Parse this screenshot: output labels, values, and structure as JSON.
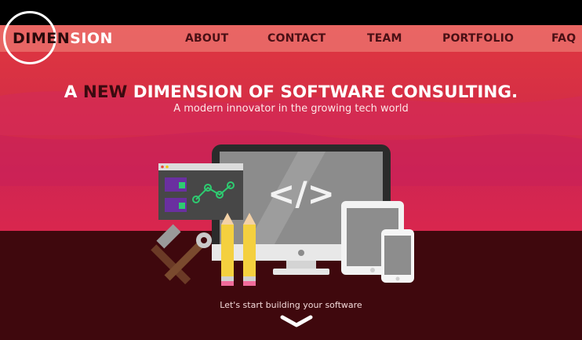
{
  "logo": {
    "part1": "DIMEN",
    "part2": "SION"
  },
  "nav": {
    "items": [
      {
        "label": "ABOUT"
      },
      {
        "label": "CONTACT"
      },
      {
        "label": "TEAM"
      },
      {
        "label": "PORTFOLIO"
      },
      {
        "label": "FAQ"
      }
    ]
  },
  "hero": {
    "headline_a": "A ",
    "headline_new": "NEW",
    "headline_b": " DIMENSION OF SOFTWARE CONSULTING.",
    "subtitle": "A modern innovator in the growing tech world"
  },
  "illustration": {
    "code_symbol": "</>"
  },
  "cta": {
    "text": "Let's start building your software"
  },
  "colors": {
    "hero_red": "#d62f45",
    "footer_dark": "#3f080d",
    "nav_text": "#4a1015",
    "accent_green": "#2ecc71"
  },
  "icons": {
    "logo_ring": "circle-outline",
    "code": "code-brackets-icon",
    "chevron": "chevron-down-icon"
  }
}
